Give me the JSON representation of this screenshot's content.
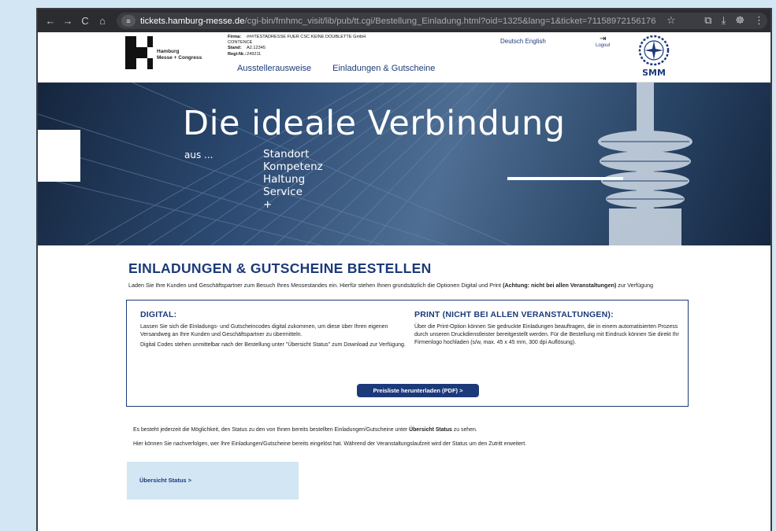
{
  "browser": {
    "nav_back": "←",
    "nav_forward": "→",
    "nav_reload": "C",
    "nav_home": "⌂",
    "url_host": "tickets.hamburg-messe.de",
    "url_path": "/cgi-bin/fmhmc_visit/lib/pub/tt.cgi/Bestellung_Einladung.html?oid=1325&lang=1&ticket=71158972156176"
  },
  "header": {
    "logo_line1": "Hamburg",
    "logo_line2": "Messe + Congress",
    "company": {
      "firma_label": "Firma:",
      "firma_value": "###TESTADRESSE FUER CSC KEINE DOUBLETTE GmbH",
      "firma_value2": "CONTENCE",
      "stand_label": "Stand:",
      "stand_value": "A2.12345",
      "reg_label": "Regi-Nr.:",
      "reg_value": "249211"
    },
    "nav": [
      "Ausstellerausweise",
      "Einladungen & Gutscheine"
    ],
    "lang_de": "Deutsch",
    "lang_en": "English",
    "logout": "Logout",
    "brand": "SMM"
  },
  "hero": {
    "title": "Die ideale Verbindung",
    "aus": "aus ...",
    "items": [
      "Standort",
      "Kompetenz",
      "Haltung",
      "Service",
      "+"
    ]
  },
  "main": {
    "heading": "EINLADUNGEN & GUTSCHEINE BESTELLEN",
    "intro_text": "Laden Sie Ihre Kunden und Geschäftspartner zum Besuch Ihres Messestandes ein. Hierfür stehen Ihnen grundsätzlich die Optionen Digital und Print ",
    "intro_bold": "(Achtung: nicht bei allen Veranstaltungen)",
    "intro_end": " zur Verfügung",
    "digital_title": "DIGITAL:",
    "digital_p1": "Lassen Sie sich die Einladungs- und Gutscheincodes digital zukommen, um diese über Ihren eigenen Versandweg an Ihre Kunden und Geschäftspartner zu übermitteln.",
    "digital_p2": "Digital Codes stehen unmittelbar nach der Bestellung unter \"Übersicht Status\" zum Download zur Verfügung.",
    "print_title": "PRINT (NICHT BEI ALLEN VERANSTALTUNGEN):",
    "print_p1": "Über die Print-Option können Sie gedruckte Einladungen beauftragen, die in einem automatisierten Prozess durch unseren Druckdienstleister bereitgestellt werden. Für die Bestellung mit Eindruck können Sie direkt Ihr Firmenlogo hochladen (s/w, max. 45 x 45 mm, 300 dpi Auflösung).",
    "price_button": "Preisliste herunterladen (PDF)  >",
    "info1_text": "Es besteht jederzeit die Möglichkeit, den Status zu den von Ihnen bereits bestellten Einladungen/Gutscheine unter ",
    "info1_bold": "Übersicht Status",
    "info1_end": " zu sehen.",
    "info2": "Hier können Sie nachverfolgen, wer Ihre Einladungen/Gutscheine bereits eingelöst hat. Während der Veranstaltungslaufzeit wird der Status um den Zutritt erweitert.",
    "status_button": "Übersicht Status >"
  }
}
